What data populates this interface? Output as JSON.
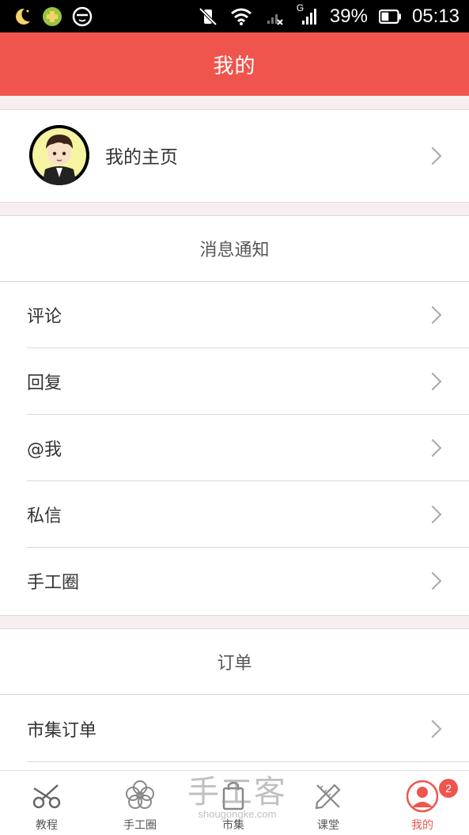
{
  "status_bar": {
    "battery": "39%",
    "time": "05:13",
    "network_type": "G",
    "icons": [
      "moon-icon",
      "medical-cross-icon",
      "face-icon",
      "muted-vibrate-icon",
      "wifi-icon",
      "signal-no-service-icon",
      "signal-icon",
      "battery-icon"
    ]
  },
  "header": {
    "title": "我的"
  },
  "profile": {
    "label": "我的主页"
  },
  "notifications": {
    "title": "消息通知",
    "items": [
      {
        "label": "评论"
      },
      {
        "label": "回复"
      },
      {
        "label": "@我"
      },
      {
        "label": "私信"
      },
      {
        "label": "手工圈"
      }
    ]
  },
  "orders": {
    "title": "订单",
    "items": [
      {
        "label": "市集订单"
      }
    ]
  },
  "tabbar": {
    "tabs": [
      {
        "label": "教程",
        "icon": "scissors-icon"
      },
      {
        "label": "手工圈",
        "icon": "flower-icon"
      },
      {
        "label": "市集",
        "icon": "shopping-bag-icon"
      },
      {
        "label": "课堂",
        "icon": "pencil-ruler-icon"
      },
      {
        "label": "我的",
        "icon": "user-icon",
        "active": true,
        "badge": "2"
      }
    ]
  },
  "watermark": {
    "brand": "手工客",
    "url": "shougongke.com"
  },
  "colors": {
    "accent": "#ef554d",
    "background": "#f6eeef"
  }
}
